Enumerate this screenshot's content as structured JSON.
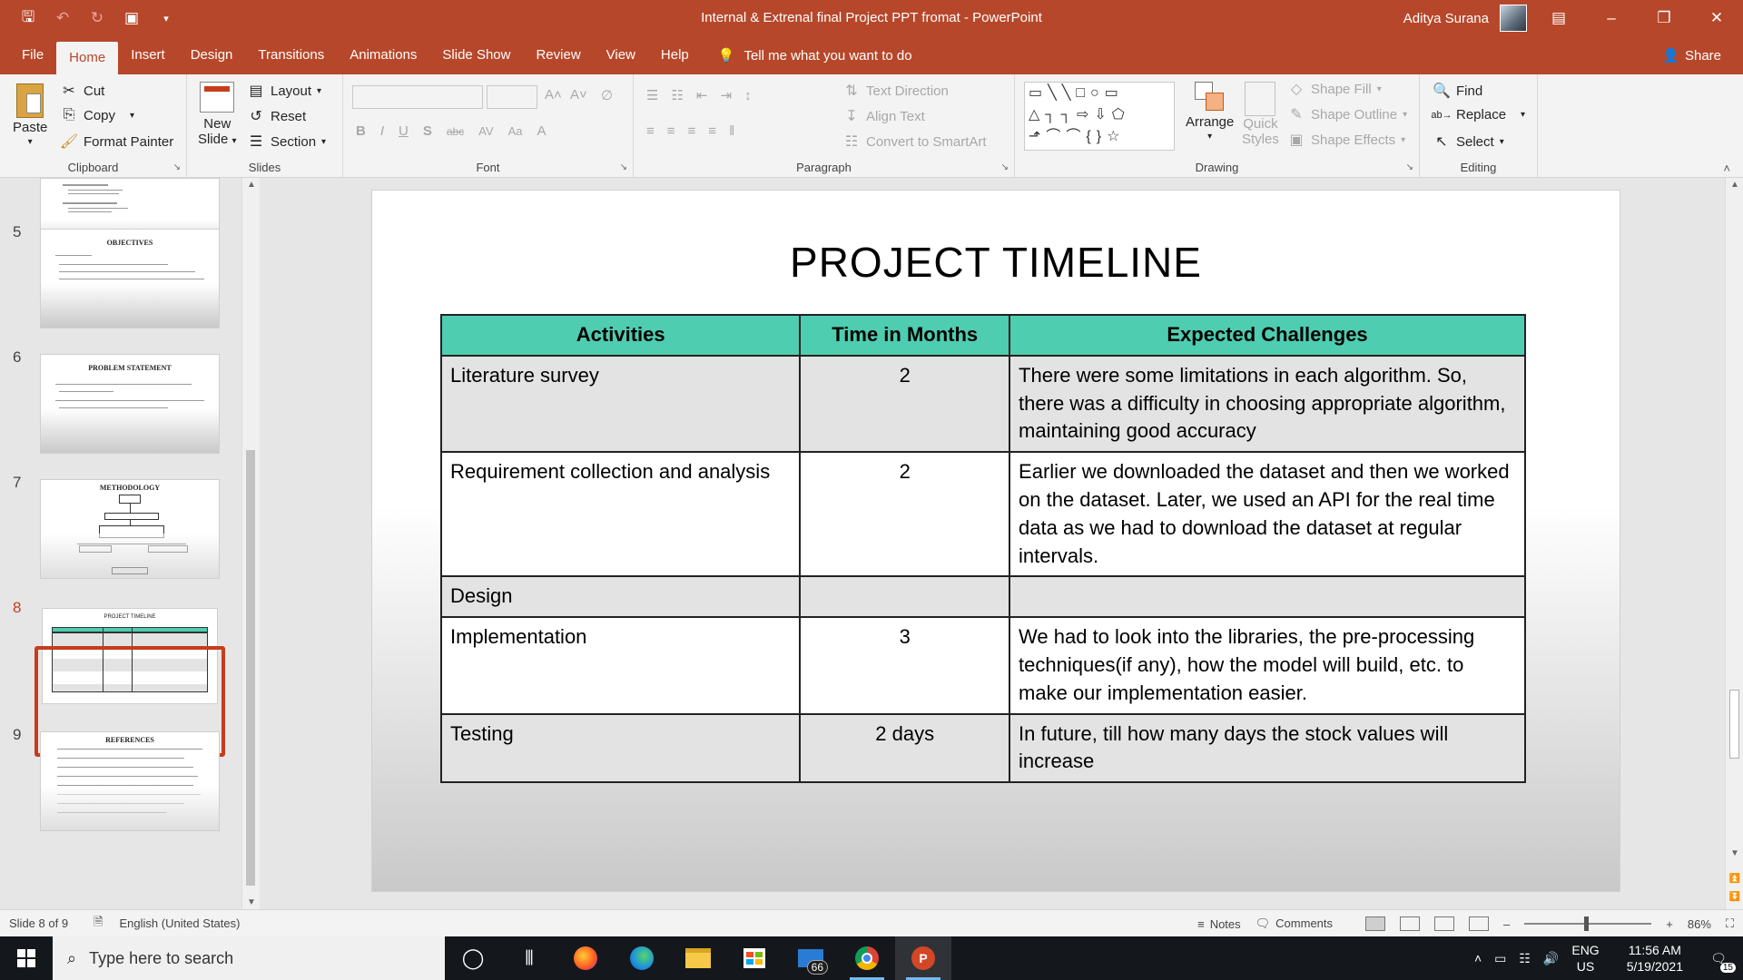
{
  "window": {
    "title": "Internal & Extrenal final Project PPT fromat  -  PowerPoint",
    "user": "Aditya Surana"
  },
  "ribbon_tabs": [
    "File",
    "Home",
    "Insert",
    "Design",
    "Transitions",
    "Animations",
    "Slide Show",
    "Review",
    "View",
    "Help"
  ],
  "tell_me": "Tell me what you want to do",
  "share": "Share",
  "clipboard": {
    "paste": "Paste",
    "cut": "Cut",
    "copy": "Copy",
    "format_painter": "Format Painter",
    "label": "Clipboard"
  },
  "slides_group": {
    "new_slide_1": "New",
    "new_slide_2": "Slide",
    "layout": "Layout",
    "reset": "Reset",
    "section": "Section",
    "label": "Slides"
  },
  "font_group": {
    "label": "Font"
  },
  "paragraph_group": {
    "text_direction": "Text Direction",
    "align_text": "Align Text",
    "convert_smartart": "Convert to SmartArt",
    "label": "Paragraph"
  },
  "drawing_group": {
    "arrange": "Arrange",
    "quick_styles_1": "Quick",
    "quick_styles_2": "Styles",
    "shape_fill": "Shape Fill",
    "shape_outline": "Shape Outline",
    "shape_effects": "Shape Effects",
    "label": "Drawing"
  },
  "editing_group": {
    "find": "Find",
    "replace": "Replace",
    "select": "Select",
    "label": "Editing"
  },
  "thumbnails": [
    {
      "num": "5",
      "title": "OBJECTIVES"
    },
    {
      "num": "6",
      "title": "PROBLEM STATEMENT"
    },
    {
      "num": "7",
      "title": "METHODOLOGY"
    },
    {
      "num": "8",
      "title": "PROJECT TIMELINE"
    },
    {
      "num": "9",
      "title": "REFERENCES"
    }
  ],
  "slide": {
    "title": "PROJECT TIMELINE",
    "columns": [
      "Activities",
      "Time in Months",
      "Expected Challenges"
    ],
    "rows": [
      {
        "activity": "Literature survey",
        "time": "2",
        "challenge": "There were some limitations in each algorithm. So, there was a difficulty in choosing appropriate algorithm, maintaining good accuracy"
      },
      {
        "activity": "Requirement collection and analysis",
        "time": "2",
        "challenge": "Earlier we downloaded the dataset and then we worked on the dataset. Later, we used an API for the real time data as we had to download the dataset at regular intervals."
      },
      {
        "activity": "Design",
        "time": "",
        "challenge": ""
      },
      {
        "activity": "Implementation",
        "time": "3",
        "challenge": "We had to look into the libraries, the pre-processing techniques(if any), how the model will build, etc. to make our implementation easier."
      },
      {
        "activity": "Testing",
        "time": "2 days",
        "challenge": "In future, till how many days the stock values will increase"
      }
    ]
  },
  "status": {
    "slide_of": "Slide 8 of 9",
    "language": "English (United States)",
    "notes": "Notes",
    "comments": "Comments",
    "zoom": "86%"
  },
  "taskbar": {
    "search_placeholder": "Type here to search",
    "mail_badge": "66",
    "lang_1": "ENG",
    "lang_2": "US",
    "time": "11:56 AM",
    "date": "5/19/2021",
    "notifications": "15"
  },
  "colors": {
    "accent": "#b7472a",
    "table_header": "#4ecdb0",
    "selection": "#c43e1c"
  }
}
